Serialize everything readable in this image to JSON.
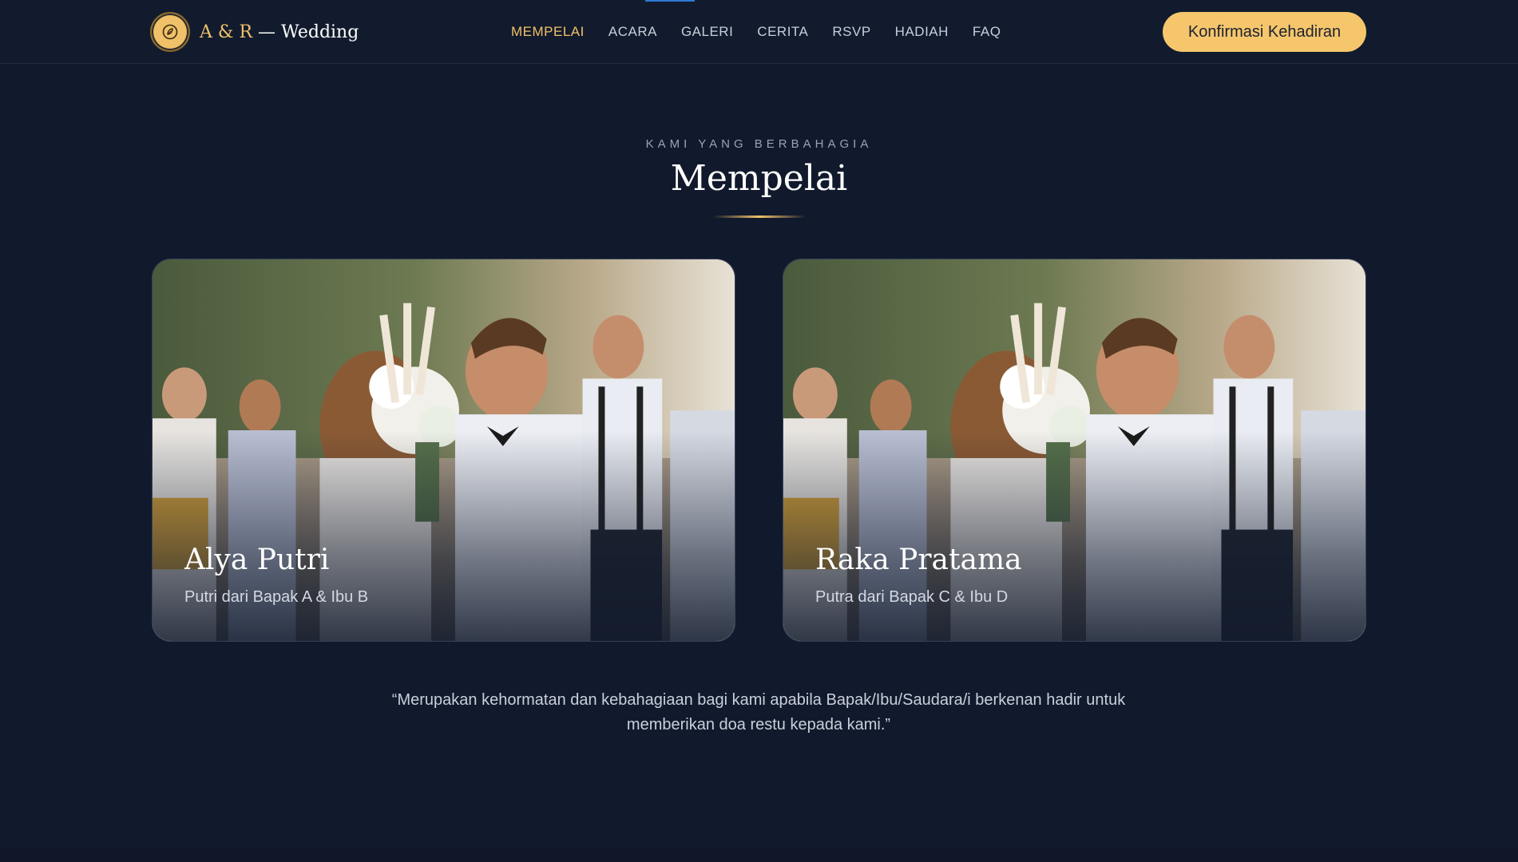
{
  "brand": {
    "initials": "A & R",
    "rest": " — Wedding",
    "logo_icon": "flower-icon"
  },
  "nav": {
    "items": [
      {
        "label": "MEMPELAI",
        "active": true
      },
      {
        "label": "ACARA",
        "active": false
      },
      {
        "label": "GALERI",
        "active": false
      },
      {
        "label": "CERITA",
        "active": false
      },
      {
        "label": "RSVP",
        "active": false
      },
      {
        "label": "HADIAH",
        "active": false
      },
      {
        "label": "FAQ",
        "active": false
      }
    ]
  },
  "cta": {
    "label": "Konfirmasi Kehadiran"
  },
  "section": {
    "eyebrow": "KAMI YANG BERBAHAGIA",
    "title": "Mempelai"
  },
  "couple": [
    {
      "name": "Alya Putri",
      "parents": "Putri dari Bapak A & Ibu B"
    },
    {
      "name": "Raka Pratama",
      "parents": "Putra dari Bapak C & Ibu D"
    }
  ],
  "quote": {
    "text": "“Merupakan kehormatan dan kebahagiaan bagi kami apabila Bapak/Ibu/Saudara/i berkenan hadir untuk memberikan doa restu kepada kami.”"
  },
  "colors": {
    "background": "#111a2c",
    "accent": "#f0c169",
    "cta_bg": "#f5c66c"
  }
}
